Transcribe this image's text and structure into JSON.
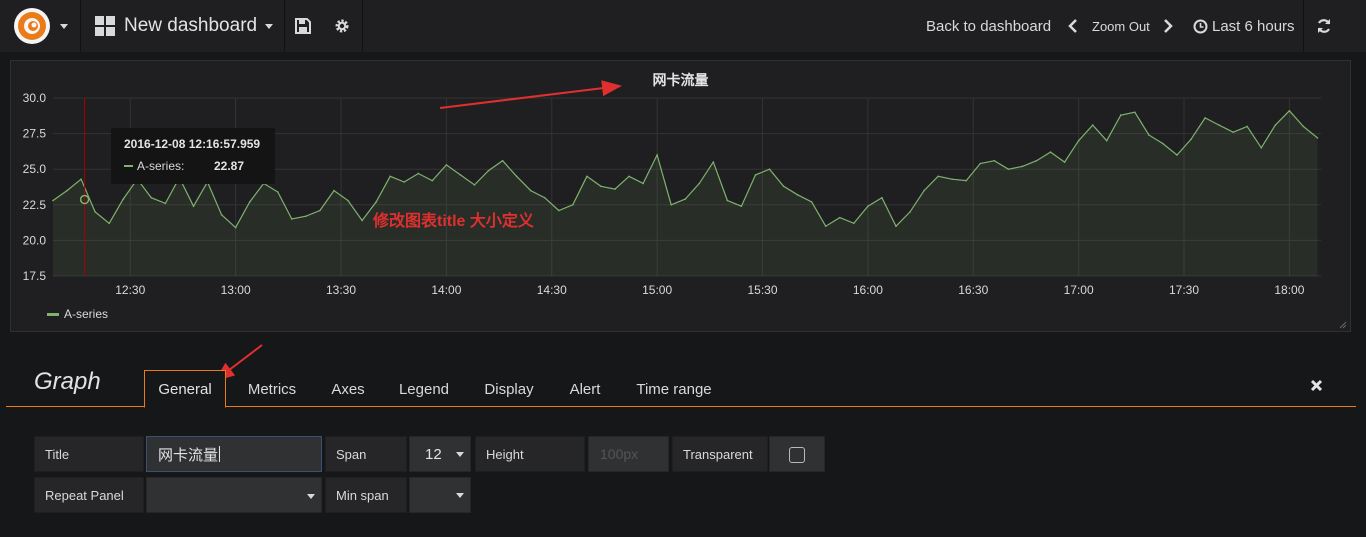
{
  "topbar": {
    "dashboard_title": "New dashboard",
    "back_label": "Back to dashboard",
    "zoom_out_label": "Zoom Out",
    "time_range_label": "Last 6 hours"
  },
  "panel": {
    "title": "网卡流量",
    "annotation_text": "修改图表title 大小定义",
    "tooltip": {
      "time": "2016-12-08 12:16:57.959",
      "series": "A-series:",
      "value": "22.87"
    },
    "legend_label": "A-series"
  },
  "chart_data": {
    "type": "line",
    "title": "网卡流量",
    "x_unit": "minutes after 12:00",
    "x_ticks": [
      "12:30",
      "13:00",
      "13:30",
      "14:00",
      "14:30",
      "15:00",
      "15:30",
      "16:00",
      "16:30",
      "17:00",
      "17:30",
      "18:00"
    ],
    "x_tick_values": [
      30,
      60,
      90,
      120,
      150,
      180,
      210,
      240,
      270,
      300,
      330,
      360
    ],
    "y_ticks": [
      "17.5",
      "20.0",
      "22.5",
      "25.0",
      "27.5",
      "30.0"
    ],
    "ylim": [
      17.5,
      30.0
    ],
    "xlim": [
      8,
      369
    ],
    "grid": true,
    "legend_position": "bottom-left",
    "series": [
      {
        "name": "A-series",
        "color": "#7eb26d",
        "x": [
          8,
          12,
          16,
          20,
          24,
          28,
          32,
          36,
          40,
          44,
          48,
          52,
          56,
          60,
          64,
          68,
          72,
          76,
          80,
          84,
          88,
          92,
          96,
          100,
          104,
          108,
          112,
          116,
          120,
          124,
          128,
          132,
          136,
          140,
          144,
          148,
          152,
          156,
          160,
          164,
          168,
          172,
          176,
          180,
          184,
          188,
          192,
          196,
          200,
          204,
          208,
          212,
          216,
          220,
          224,
          228,
          232,
          236,
          240,
          244,
          248,
          252,
          256,
          260,
          264,
          268,
          272,
          276,
          280,
          284,
          288,
          292,
          296,
          300,
          304,
          308,
          312,
          316,
          320,
          324,
          328,
          332,
          336,
          340,
          344,
          348,
          352,
          356,
          360,
          364,
          368
        ],
        "y": [
          22.8,
          23.5,
          24.3,
          22.0,
          21.2,
          22.9,
          24.3,
          23.0,
          22.6,
          24.4,
          22.4,
          24.1,
          21.8,
          20.9,
          22.7,
          24.0,
          23.4,
          21.5,
          21.7,
          22.1,
          23.5,
          22.8,
          21.4,
          22.7,
          24.5,
          24.1,
          24.7,
          24.2,
          25.3,
          24.6,
          23.9,
          24.9,
          25.6,
          24.5,
          23.5,
          23.0,
          22.1,
          22.5,
          24.5,
          23.8,
          23.6,
          24.5,
          24.0,
          26.0,
          22.5,
          22.9,
          24.0,
          25.5,
          22.8,
          22.4,
          24.6,
          25.0,
          23.8,
          23.2,
          22.7,
          21.0,
          21.6,
          21.2,
          22.4,
          23.0,
          21.0,
          22.0,
          23.5,
          24.5,
          24.3,
          24.2,
          25.4,
          25.6,
          25.0,
          25.2,
          25.6,
          26.2,
          25.5,
          27.0,
          28.1,
          27.0,
          28.8,
          29.0,
          27.4,
          26.8,
          26.0,
          27.1,
          28.6,
          28.1,
          27.6,
          28.0,
          26.5,
          28.1,
          29.1,
          28.0,
          27.2
        ]
      }
    ]
  },
  "editor": {
    "panel_type": "Graph",
    "tabs": [
      "General",
      "Metrics",
      "Axes",
      "Legend",
      "Display",
      "Alert",
      "Time range"
    ],
    "fields": {
      "title_label": "Title",
      "title_value": "网卡流量",
      "span_label": "Span",
      "span_value": "12",
      "height_label": "Height",
      "height_placeholder": "100px",
      "transparent_label": "Transparent",
      "repeat_label": "Repeat Panel",
      "min_span_label": "Min span"
    }
  },
  "colors": {
    "series": "#7eb26d",
    "annotation_red": "#e02f2f",
    "tab_accent": "#eb7b18"
  }
}
